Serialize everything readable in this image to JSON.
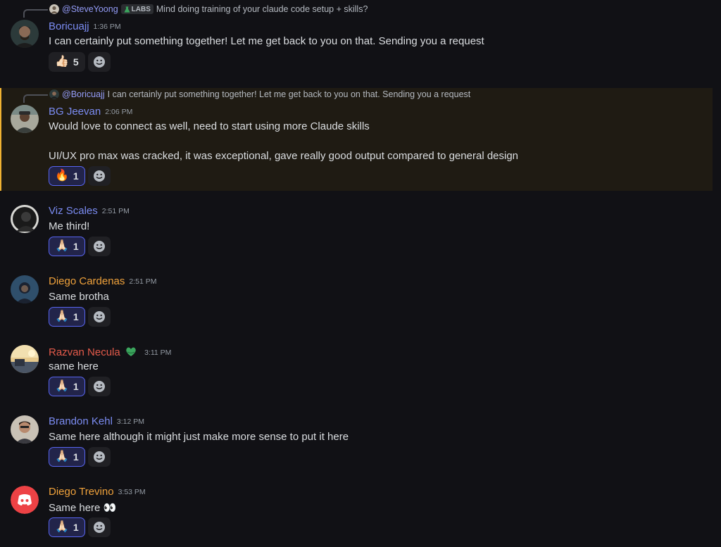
{
  "colors": {
    "background": "#111115",
    "highlight_bg": "#1f1b13",
    "highlight_bar": "#f0b232",
    "mention": "#949cf7",
    "reaction_me_border": "#5865f2",
    "name_blue": "#7b8cf2",
    "name_orange": "#f0a23b",
    "name_red": "#e35a4a"
  },
  "messages": [
    {
      "reply": {
        "mention": "@SteveYoong",
        "tag": "LABS",
        "text": "Mind doing training of your claude code setup + skills?"
      },
      "username": "Boricuajj",
      "timestamp": "1:36 PM",
      "lines": [
        "I can certainly put something together! Let me get back to you on that. Sending you a request"
      ],
      "reaction": {
        "emoji": "👍🏻",
        "count": "5",
        "me": false
      }
    },
    {
      "reply": {
        "mention": "@Boricuajj",
        "text": "I can certainly put something together! Let me get back to you on that. Sending you a request"
      },
      "username": "BG Jeevan",
      "timestamp": "2:06 PM",
      "lines": [
        "Would love to connect as well, need to start using more Claude skills",
        "UI/UX pro max was cracked, it was exceptional, gave really good output compared to general design"
      ],
      "reaction": {
        "emoji": "🔥",
        "count": "1",
        "me": true
      }
    },
    {
      "username": "Viz Scales",
      "timestamp": "2:51 PM",
      "lines": [
        "Me third!"
      ],
      "reaction": {
        "emoji": "🙏🏻",
        "count": "1",
        "me": true
      }
    },
    {
      "username": "Diego Cardenas",
      "timestamp": "2:51 PM",
      "lines": [
        "Same brotha"
      ],
      "reaction": {
        "emoji": "🙏🏻",
        "count": "1",
        "me": true
      }
    },
    {
      "username": "Razvan Necula",
      "timestamp": "3:11 PM",
      "lines": [
        "same here"
      ],
      "reaction": {
        "emoji": "🙏🏻",
        "count": "1",
        "me": true
      }
    },
    {
      "username": "Brandon Kehl",
      "timestamp": "3:12 PM",
      "lines": [
        "Same here although it might just make more sense to put it here"
      ],
      "reaction": {
        "emoji": "🙏🏻",
        "count": "1",
        "me": true
      }
    },
    {
      "username": "Diego Trevino",
      "timestamp": "3:53 PM",
      "lines": [
        "Same here 👀"
      ],
      "reaction": {
        "emoji": "🙏🏻",
        "count": "1",
        "me": true
      }
    }
  ]
}
